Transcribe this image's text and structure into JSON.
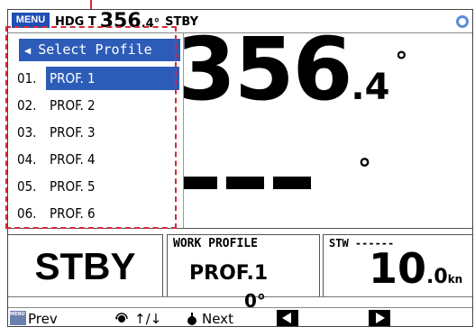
{
  "topbar": {
    "menu_label": "MENU",
    "hdg_label": "HDG T",
    "hdg_value": "356",
    "hdg_decimal": ".4°",
    "mode": "STBY"
  },
  "heading_display": {
    "value": "356",
    "decimal": ".4",
    "degree": "°",
    "secondary_degree": "°"
  },
  "profile_popup": {
    "title": "Select Profile",
    "selected_index": 0,
    "items": [
      {
        "num": "01.",
        "name": "PROF. 1"
      },
      {
        "num": "02.",
        "name": "PROF. 2"
      },
      {
        "num": "03.",
        "name": "PROF. 3"
      },
      {
        "num": "04.",
        "name": "PROF. 4"
      },
      {
        "num": "05.",
        "name": "PROF. 5"
      },
      {
        "num": "06.",
        "name": "PROF. 6"
      }
    ]
  },
  "panels": {
    "mode": "STBY",
    "work_profile_label": "WORK PROFILE",
    "work_profile_value": "PROF.1",
    "stw_label": "STW ------",
    "stw_value": "10",
    "stw_decimal": ".0",
    "stw_unit": "kn"
  },
  "rudder_strip": {
    "mark": "0°"
  },
  "softkeys": {
    "menu_esc_icon_text": "MENU ESC",
    "prev_label": "Prev",
    "updown_label": "↑/↓",
    "next_label": "Next"
  },
  "colors": {
    "accent_blue": "#2d5cb8",
    "callout_red": "#d6283a"
  }
}
